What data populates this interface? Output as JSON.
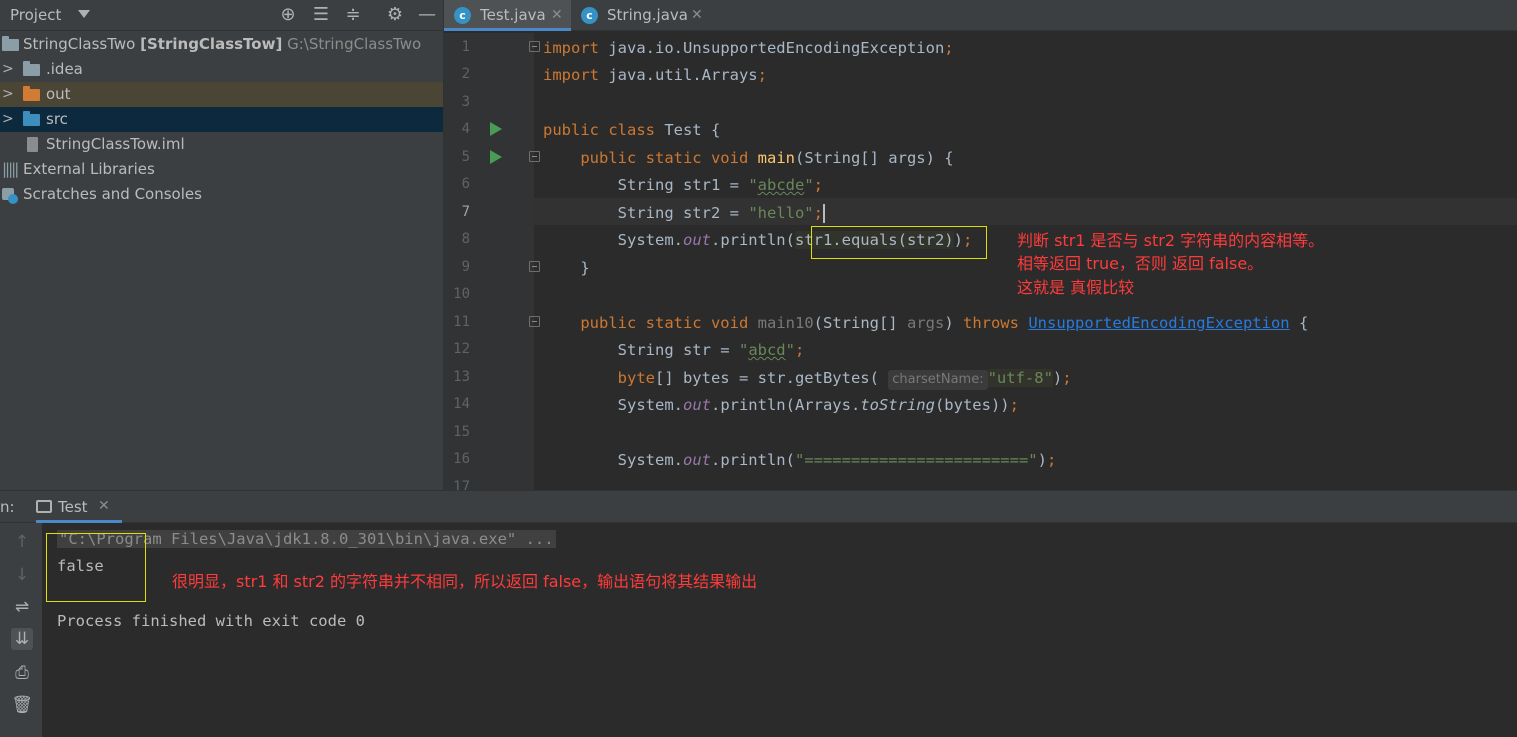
{
  "project_panel": {
    "title": "Project",
    "tree": [
      {
        "label": "StringClassTwo",
        "bold_label": "[StringClassTow]",
        "path": "G:\\StringClassTwo"
      },
      {
        "label": ".idea"
      },
      {
        "label": "out"
      },
      {
        "label": "src"
      },
      {
        "label": "StringClassTow.iml"
      },
      {
        "label": "External Libraries"
      },
      {
        "label": "Scratches and Consoles"
      }
    ]
  },
  "editor": {
    "tabs": [
      {
        "label": "Test.java",
        "active": true
      },
      {
        "label": "String.java",
        "active": false
      }
    ],
    "line_numbers": [
      "1",
      "2",
      "3",
      "4",
      "5",
      "6",
      "7",
      "8",
      "9",
      "10",
      "11",
      "12",
      "13",
      "14",
      "15",
      "16",
      "17"
    ],
    "current_line": "7",
    "param_hint": "charsetName:",
    "annotations": {
      "line1": "判断 str1 是否与 str2 字符串的内容相等。",
      "line2": "相等返回 true，否则 返回 false。",
      "line3": "这就是 真假比较"
    }
  },
  "run_panel": {
    "label": "n:",
    "tab_label": "Test",
    "command": "\"C:\\Program Files\\Java\\jdk1.8.0_301\\bin\\java.exe\" ...",
    "output": "false",
    "exit_message": "Process finished with exit code 0",
    "annotation": "很明显，str1 和 str2 的字符串并不相同，所以返回 false，输出语句将其结果输出"
  },
  "colors": {
    "keyword": "#cc7832",
    "string": "#6a8759",
    "annotation_red": "#ff3b3b",
    "highlight_box": "#e0e000",
    "run_green": "#499c54"
  }
}
